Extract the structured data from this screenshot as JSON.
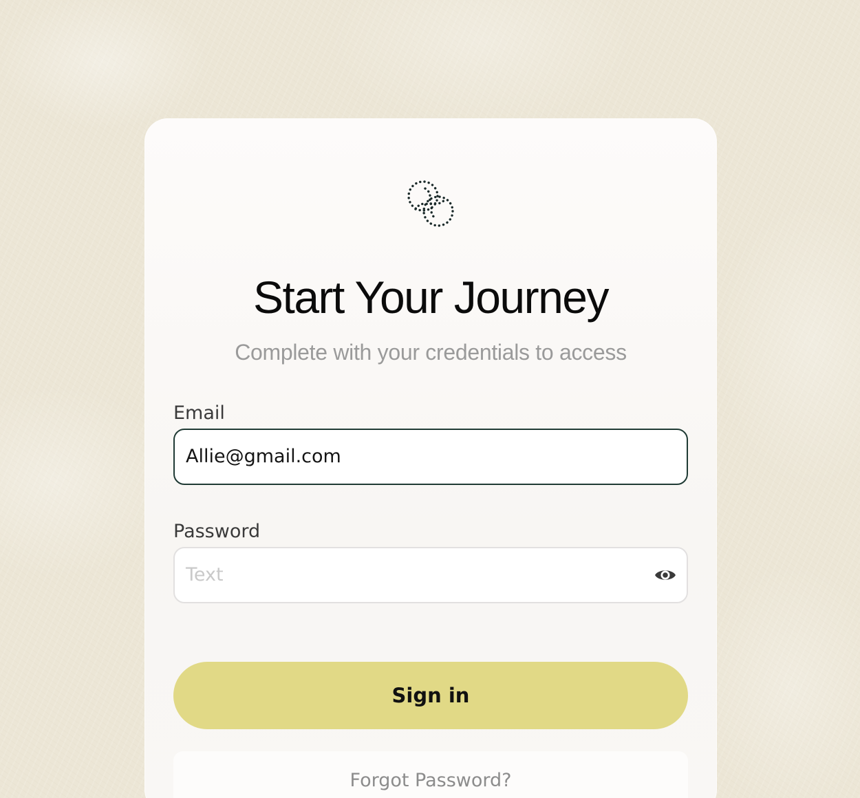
{
  "logo": {
    "icon": "dotted-interlocking-rings-logo"
  },
  "header": {
    "title": "Start Your Journey",
    "subtitle": "Complete with your credentials to access"
  },
  "form": {
    "email": {
      "label": "Email",
      "value": "Allie@gmail.com"
    },
    "password": {
      "label": "Password",
      "placeholder": "Text",
      "toggle_icon": "eye-icon"
    },
    "submit_label": "Sign in",
    "forgot_label": "Forgot Password?"
  },
  "colors": {
    "background": "#ece6d6",
    "card": "#fbf9f7",
    "button": "#e1d986",
    "email_border": "#1f3a34",
    "subtitle": "#9a9a9a"
  }
}
